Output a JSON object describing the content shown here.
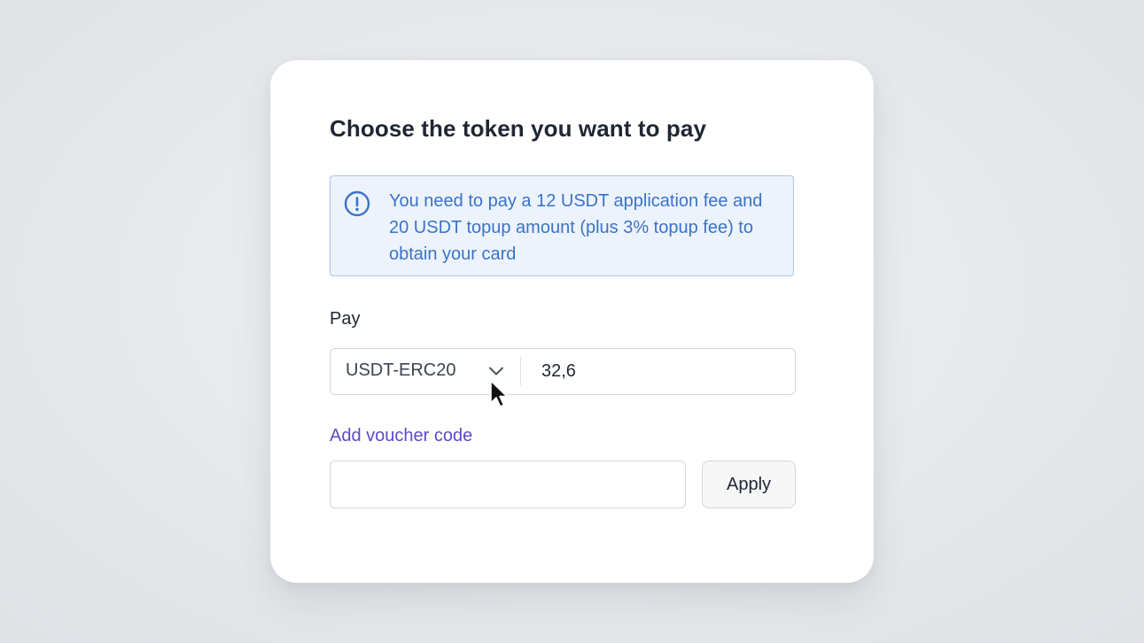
{
  "dialog": {
    "title": "Choose the token you want to pay"
  },
  "notice": {
    "icon": "exclamation-circle-icon",
    "text": "You need to pay a 12 USDT application fee and 20 USDT topup amount (plus 3% topup fee) to obtain your card",
    "color": "#3a73c7"
  },
  "payment": {
    "label": "Pay",
    "token_selected": "USDT-ERC20",
    "amount": "32,6"
  },
  "voucher": {
    "link_label": "Add voucher code",
    "input_value": "",
    "apply_label": "Apply",
    "accent": "#5a4bc7"
  }
}
